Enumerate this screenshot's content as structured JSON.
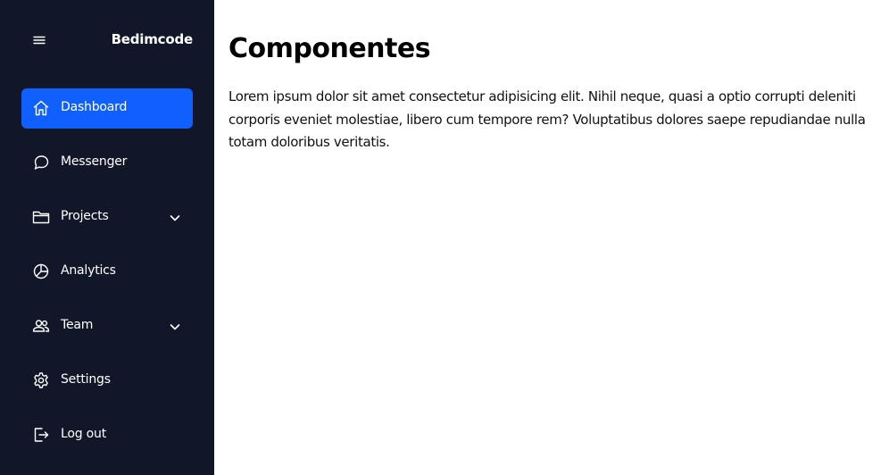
{
  "sidebar": {
    "brand": "Bedimcode",
    "menu_icon": "hamburger-icon",
    "items": [
      {
        "label": "Dashboard",
        "icon": "home-icon",
        "active": true,
        "has_submenu": false
      },
      {
        "label": "Messenger",
        "icon": "chat-icon",
        "active": false,
        "has_submenu": false
      },
      {
        "label": "Projects",
        "icon": "folder-icon",
        "active": false,
        "has_submenu": true
      },
      {
        "label": "Analytics",
        "icon": "pie-chart-icon",
        "active": false,
        "has_submenu": false
      },
      {
        "label": "Team",
        "icon": "users-icon",
        "active": false,
        "has_submenu": true
      },
      {
        "label": "Settings",
        "icon": "gear-icon",
        "active": false,
        "has_submenu": false
      },
      {
        "label": "Log out",
        "icon": "logout-icon",
        "active": false,
        "has_submenu": false
      }
    ]
  },
  "main": {
    "title": "Componentes",
    "body": "Lorem ipsum dolor sit amet consectetur adipisicing elit. Nihil neque, quasi a optio corrupti deleniti corporis eveniet molestiae, libero cum tempore rem? Voluptatibus dolores saepe repudiandae nulla totam doloribus veritatis."
  },
  "colors": {
    "sidebar_bg": "#111729",
    "active_bg": "#1060ff",
    "text_light": "#ffffff",
    "text_dark": "#000000"
  }
}
